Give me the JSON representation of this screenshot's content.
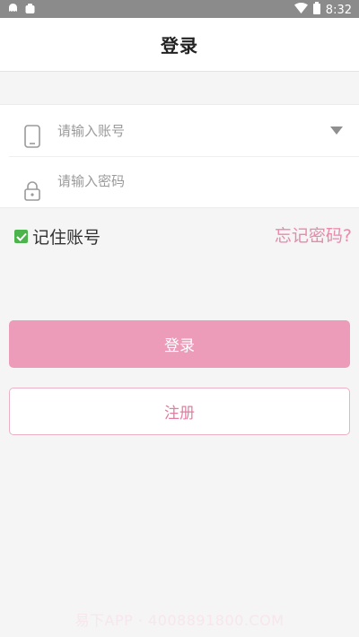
{
  "status_bar": {
    "time": "8:32",
    "left_icons": [
      "ghost-icon",
      "notification-icon"
    ],
    "right_icons": [
      "wifi-icon",
      "battery-icon"
    ]
  },
  "header": {
    "title": "登录"
  },
  "form": {
    "account": {
      "placeholder": "请输入账号",
      "value": "",
      "icon": "phone-icon"
    },
    "password": {
      "placeholder": "请输入密码",
      "value": "",
      "icon": "lock-icon"
    }
  },
  "options": {
    "remember_label": "记住账号",
    "remember_checked": true,
    "forgot_label": "忘记密码?"
  },
  "buttons": {
    "login_label": "登录",
    "register_label": "注册"
  },
  "watermark": "易下APP · 4008891800.COM",
  "colors": {
    "accent": "#ec9bb8",
    "accent_text": "#e27ca1",
    "check_green": "#4bb54b",
    "status_bar": "#8b8b8b"
  }
}
